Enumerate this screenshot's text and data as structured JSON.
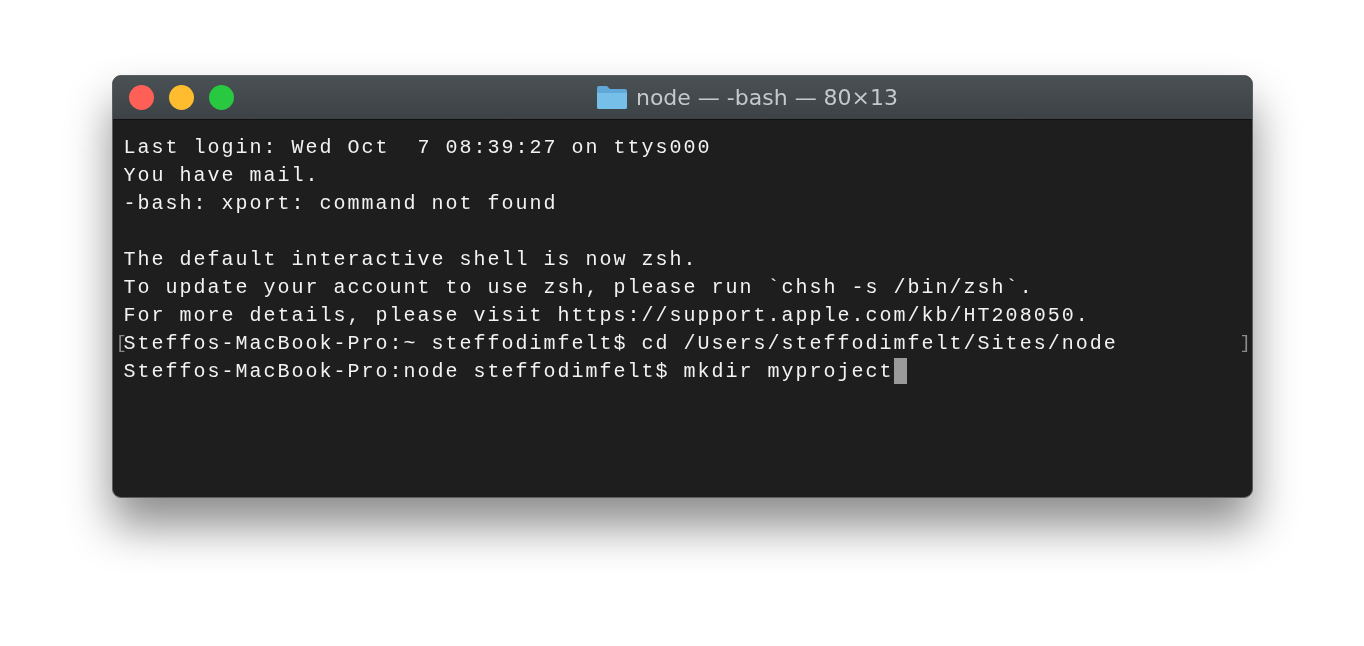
{
  "window": {
    "title": "node — -bash — 80×13"
  },
  "terminal": {
    "blocks": [
      [
        {
          "text": "Last login: Wed Oct  7 08:39:27 on ttys000"
        },
        {
          "text": "You have mail."
        },
        {
          "text": "-bash: xport: command not found"
        }
      ],
      [
        {
          "text": "The default interactive shell is now zsh."
        },
        {
          "text": "To update your account to use zsh, please run `chsh -s /bin/zsh`."
        },
        {
          "text": "For more details, please visit https://support.apple.com/kb/HT208050."
        },
        {
          "text": "Steffos-MacBook-Pro:~ steffodimfelt$ cd /Users/steffodimfelt/Sites/node",
          "mark_left": "[",
          "mark_right": "]"
        },
        {
          "text": "Steffos-MacBook-Pro:node steffodimfelt$ mkdir myproject",
          "cursor": true
        }
      ]
    ]
  }
}
